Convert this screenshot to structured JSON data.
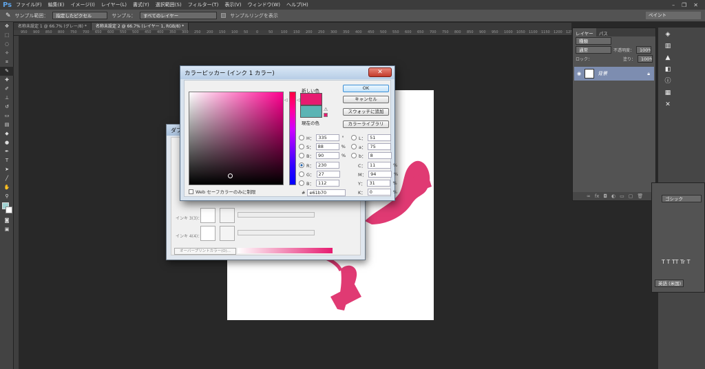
{
  "menubar": {
    "logo": "Ps",
    "items": [
      "ファイル(F)",
      "編集(E)",
      "イメージ(I)",
      "レイヤー(L)",
      "書式(Y)",
      "選択範囲(S)",
      "フィルター(T)",
      "表示(V)",
      "ウィンドウ(W)",
      "ヘルプ(H)"
    ]
  },
  "options": {
    "sample_size_label": "サンプル範囲：",
    "sample_size_value": "指定したピクセル",
    "sample_label": "サンプル：",
    "sample_value": "すべてのレイヤー",
    "show_ring": "サンプルリングを表示",
    "workspace": "ペイント"
  },
  "tabs": [
    {
      "label": "名称未設定 1 @ 66.7% (グレー/8) *",
      "active": false
    },
    {
      "label": "名称未設定 2 @ 66.7% (レイヤー 1, RGB/8) *",
      "active": true
    }
  ],
  "ruler_ticks": [
    "950",
    "900",
    "850",
    "800",
    "750",
    "700",
    "650",
    "600",
    "550",
    "500",
    "450",
    "400",
    "350",
    "300",
    "250",
    "200",
    "150",
    "100",
    "50",
    "0",
    "50",
    "100",
    "150",
    "200",
    "250",
    "300",
    "350",
    "400",
    "450",
    "500",
    "550",
    "600",
    "650",
    "700",
    "750",
    "800",
    "850",
    "900",
    "950",
    "1000",
    "1050",
    "1100",
    "1150",
    "1200",
    "1250",
    "1300",
    "1350",
    "1400",
    "1450",
    "1500",
    "1550",
    "1600",
    "1650",
    "1700",
    "1750"
  ],
  "layers_panel": {
    "tab_layers": "レイヤー",
    "tab_paths": "パス",
    "filter": "種類",
    "blend": "通常",
    "opacity_label": "不透明度：",
    "opacity": "100%",
    "lock_label": "ロック：",
    "fill_label": "塗り：",
    "fill": "100%",
    "layer_name": "背景"
  },
  "char_panel": {
    "font": "ゴシック",
    "language": "英語 (米国)"
  },
  "dialog2": {
    "title": "ダブ",
    "ink3": "インキ 3(3)：",
    "ink4": "インキ 4(4)：",
    "overprint": "オーバープリントカラー(O)..."
  },
  "picker": {
    "title": "カラーピッカー (インク 1 カラー)",
    "close": "✕",
    "new_label": "新しい色",
    "current_label": "現在の色",
    "new_color": "#e61b70",
    "current_color": "#5bb4b4",
    "ok": "OK",
    "cancel": "キャンセル",
    "add_swatch": "スウォッチに追加",
    "libraries": "カラーライブラリ",
    "web_safe": "Web セーフカラーのみに制限",
    "hex_label": "#",
    "hex": "e61b70",
    "fields_left": [
      {
        "label": "H：",
        "value": "335",
        "unit": "°"
      },
      {
        "label": "S：",
        "value": "88",
        "unit": "%"
      },
      {
        "label": "B：",
        "value": "90",
        "unit": "%"
      },
      {
        "label": "R：",
        "value": "230",
        "unit": ""
      },
      {
        "label": "G：",
        "value": "27",
        "unit": ""
      },
      {
        "label": "B：",
        "value": "112",
        "unit": ""
      }
    ],
    "fields_lab": [
      {
        "label": "L：",
        "value": "51"
      },
      {
        "label": "a：",
        "value": "75"
      },
      {
        "label": "b：",
        "value": "8"
      }
    ],
    "fields_cmyk": [
      {
        "label": "C：",
        "value": "11",
        "unit": "%"
      },
      {
        "label": "M：",
        "value": "94",
        "unit": "%"
      },
      {
        "label": "Y：",
        "value": "31",
        "unit": "%"
      },
      {
        "label": "K：",
        "value": "0",
        "unit": "%"
      }
    ]
  }
}
